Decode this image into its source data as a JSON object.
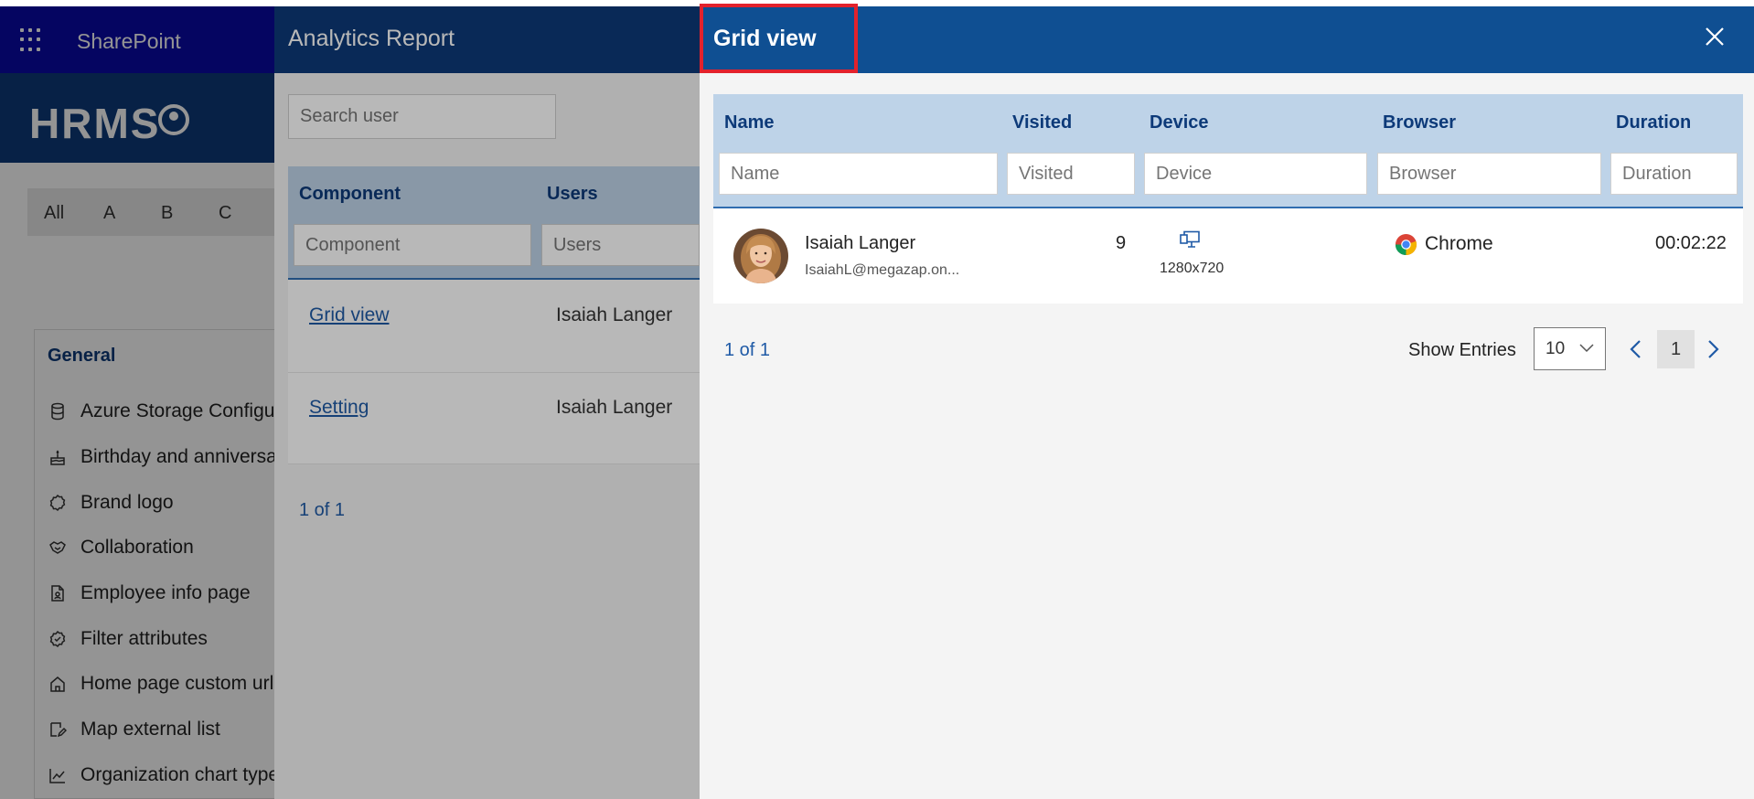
{
  "sharepoint": {
    "app_title": "SharePoint",
    "brand": "HRMS",
    "alphabet": [
      "All",
      "A",
      "B",
      "C"
    ],
    "settings_heading": "General",
    "settings_items": [
      {
        "label": "Azure Storage Configu",
        "icon": "database-icon"
      },
      {
        "label": "Birthday and anniversa",
        "icon": "cake-icon"
      },
      {
        "label": "Brand logo",
        "icon": "badge-icon"
      },
      {
        "label": "Collaboration",
        "icon": "handshake-icon"
      },
      {
        "label": "Employee info page",
        "icon": "document-person-icon"
      },
      {
        "label": "Filter attributes",
        "icon": "badge-check-icon"
      },
      {
        "label": "Home page custom url",
        "icon": "home-icon"
      },
      {
        "label": "Map external list",
        "icon": "map-edit-icon"
      },
      {
        "label": "Organization chart type",
        "icon": "chart-icon"
      }
    ]
  },
  "analytics_report": {
    "title": "Analytics Report",
    "search_placeholder": "Search user",
    "columns": [
      "Component",
      "Users"
    ],
    "filter_placeholders": [
      "Component",
      "Users"
    ],
    "rows": [
      {
        "component": "Grid view",
        "user": "Isaiah Langer"
      },
      {
        "component": "Setting",
        "user": "Isaiah Langer"
      }
    ],
    "pagination": "1 of 1"
  },
  "grid_view": {
    "title": "Grid view",
    "columns": [
      "Name",
      "Visited",
      "Device",
      "Browser",
      "Duration"
    ],
    "filter_placeholders": [
      "Name",
      "Visited",
      "Device",
      "Browser",
      "Duration"
    ],
    "rows": [
      {
        "name": "Isaiah Langer",
        "email": "IsaiahL@megazap.on...",
        "visited": "9",
        "device_resolution": "1280x720",
        "browser": "Chrome",
        "duration": "00:02:22"
      }
    ],
    "pagination": "1 of 1",
    "show_entries_label": "Show Entries",
    "entries_selected": "10",
    "current_page": "1"
  },
  "colors": {
    "suite_bar": "#0a0aa8",
    "header_blue": "#0d3a79",
    "grid_header": "#0f4f92",
    "table_header_bg": "#bed3e8",
    "link_blue": "#1f5aa6",
    "highlight_red": "#e3222c"
  }
}
